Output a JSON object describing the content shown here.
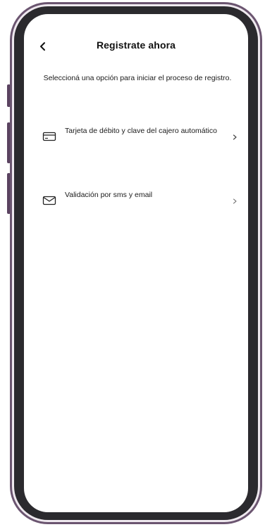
{
  "header": {
    "title": "Registrate ahora",
    "back_icon": "chevron-left-icon"
  },
  "instruction": "Seleccioná una opción para iniciar el proceso de registro.",
  "options": [
    {
      "label": "Tarjeta de débito y clave del cajero automático",
      "icon": "credit-card-icon"
    },
    {
      "label": "Validación por sms y email",
      "icon": "envelope-icon"
    }
  ],
  "colors": {
    "frame": "#6b5570",
    "bezel": "#2b2a2e",
    "screen": "#ffffff",
    "text": "#111111"
  }
}
